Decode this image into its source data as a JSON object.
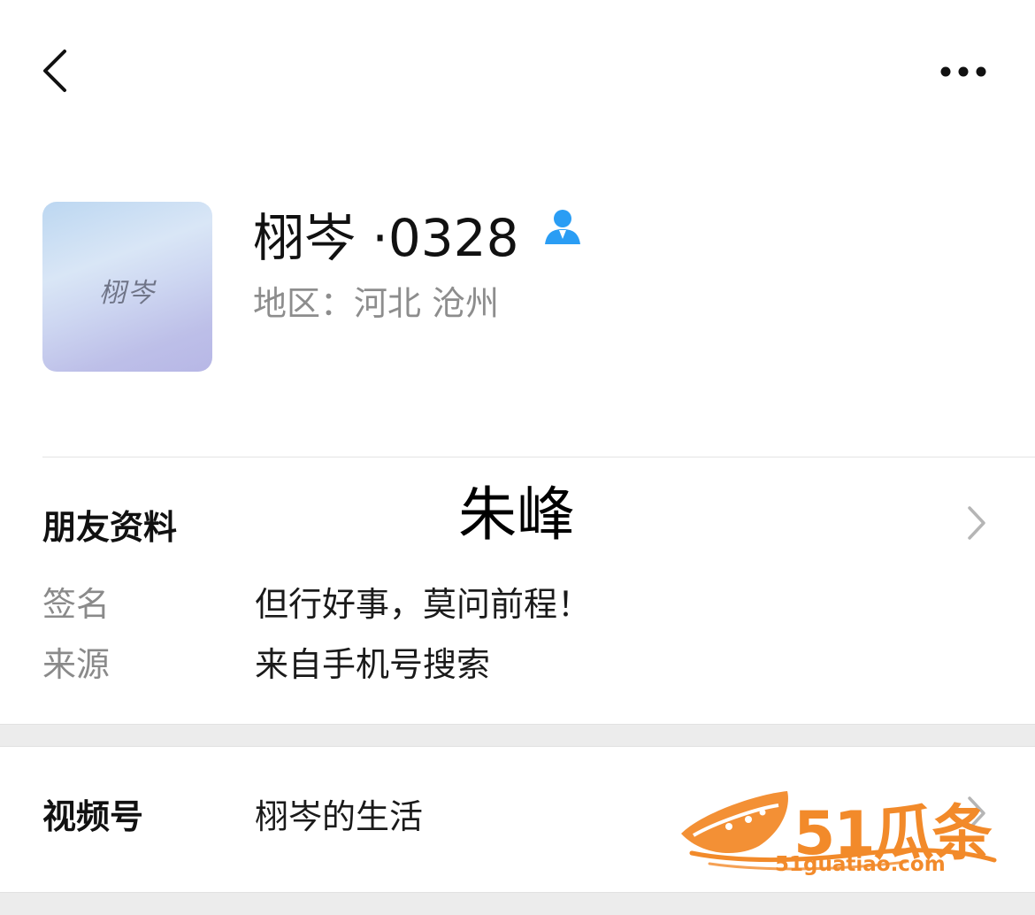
{
  "icons": {
    "back": "chevron-left-icon",
    "more": "more-horizontal-icon",
    "contact": "contact-person-icon",
    "chevron": "chevron-right-icon"
  },
  "colors": {
    "contact_icon": "#2a9df4",
    "watermark": "#f28a2a",
    "section_gap": "#ececec"
  },
  "profile": {
    "avatar_text": "栩岑",
    "display_name": "栩岑 ·0328",
    "region": "地区：河北 沧州"
  },
  "overlay_name": "朱峰",
  "friend_info": {
    "title": "朋友资料",
    "rows": [
      {
        "label": "签名",
        "value": "但行好事，莫问前程！"
      },
      {
        "label": "来源",
        "value": "来自手机号搜索"
      }
    ]
  },
  "video": {
    "label": "视频号",
    "value": "栩岑的生活"
  },
  "watermark": {
    "brand": "51瓜条",
    "url": "51guatiao.com"
  }
}
